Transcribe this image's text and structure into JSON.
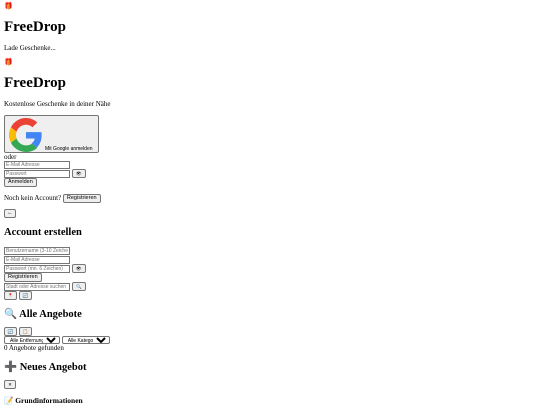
{
  "loading_screen": {
    "logo_icon": "🎁",
    "title": "FreeDrop",
    "message": "Lade Geschenke..."
  },
  "auth_screen": {
    "logo_icon": "🎁",
    "title": "FreeDrop",
    "tagline": "Kostenlose Geschenke in deiner Nähe",
    "google_button_label": "Mit Google anmelden",
    "divider_text": "oder",
    "email_placeholder": "E-Mail Adresse",
    "password_placeholder": "Passwort",
    "toggle_password_icon": "👁",
    "login_button": "Anmelden",
    "no_account_text": "Noch kein Account?",
    "register_link": "Registrieren"
  },
  "register_screen": {
    "back_icon": "←",
    "title": "Account erstellen",
    "username_placeholder": "Benutzername (3-10 Zeichen)",
    "email_placeholder": "E-Mail Adresse",
    "password_placeholder": "Passwort (mn. 6 Zeichen)",
    "toggle_password_icon": "👁",
    "register_button": "Registrieren"
  },
  "location_bar": {
    "search_placeholder": "Stadt oder Adresse suchen",
    "search_icon": "🔍",
    "pin_icon": "📍",
    "refresh_icon": "🔄"
  },
  "offers_section": {
    "icon": "🔍",
    "title": "Alle Angebote",
    "refresh_icon": "🔄",
    "list_icon": "📋",
    "distance_filter": "Alle Entfernungen",
    "category_filter": "Alle Kategorien",
    "count_text": "0 Angebote gefunden"
  },
  "new_offer_section": {
    "icon": "➕",
    "title": "Neues Angebot",
    "close_icon": "✕",
    "basic_info_icon": "📝",
    "basic_info_title": "Grundinformationen"
  }
}
